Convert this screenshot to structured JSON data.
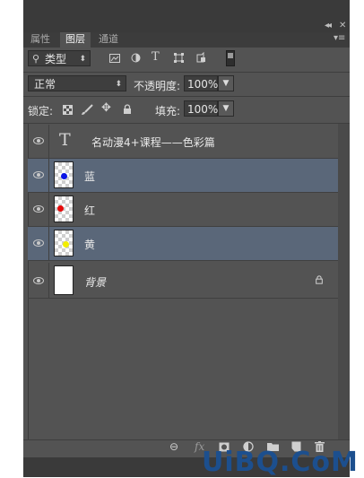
{
  "tabs": [
    {
      "label": "属性",
      "active": false
    },
    {
      "label": "图层",
      "active": true
    },
    {
      "label": "通道",
      "active": false
    }
  ],
  "filter": {
    "kind_label": "类型"
  },
  "blend": {
    "mode": "正常",
    "opacity_label": "不透明度:",
    "opacity_value": "100%"
  },
  "lock": {
    "label": "锁定:",
    "fill_label": "填充:",
    "fill_value": "100%"
  },
  "layers": [
    {
      "name": "名动漫4+课程——色彩篇",
      "type": "text",
      "selected": false
    },
    {
      "name": "蓝",
      "type": "image",
      "dot_color": "#0a14e6",
      "selected": true
    },
    {
      "name": "红",
      "type": "image",
      "dot_color": "#e60a0a",
      "selected": false
    },
    {
      "name": "黄",
      "type": "image",
      "dot_color": "#f2ee00",
      "selected": true
    },
    {
      "name": "背景",
      "type": "background",
      "selected": false,
      "locked": true
    }
  ],
  "watermark": "UiBQ.CoM",
  "colors": {
    "panel": "#535353",
    "selected_row": "#5a6779",
    "dark": "#3a3a3a"
  }
}
